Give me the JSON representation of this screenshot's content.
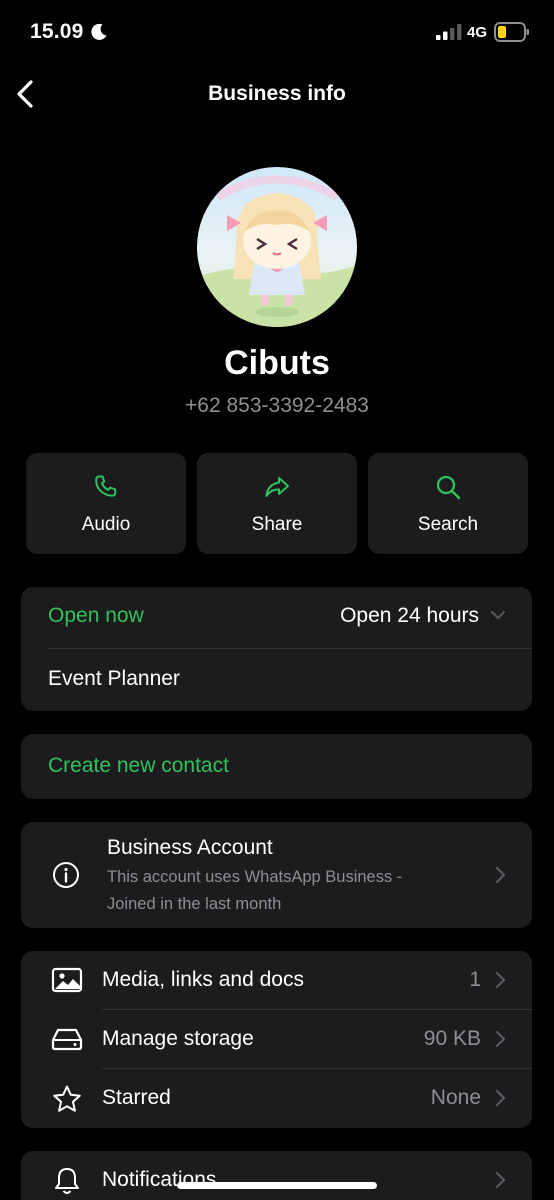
{
  "status_bar": {
    "time": "15.09",
    "network": "4G",
    "battery_color": "#ffd60a"
  },
  "header": {
    "title": "Business info"
  },
  "profile": {
    "name": "Cibuts",
    "phone": "+62 853-3392-2483"
  },
  "actions": [
    {
      "label": "Audio",
      "icon": "phone-icon"
    },
    {
      "label": "Share",
      "icon": "share-icon"
    },
    {
      "label": "Search",
      "icon": "search-icon"
    }
  ],
  "hours": {
    "status": "Open now",
    "value": "Open 24 hours",
    "category": "Event Planner"
  },
  "contact": {
    "create_label": "Create new contact"
  },
  "business_account": {
    "title": "Business Account",
    "description_line1": "This account uses WhatsApp Business -",
    "description_line2": "Joined in the last month"
  },
  "media": [
    {
      "label": "Media, links and docs",
      "value": "1",
      "icon": "image-icon"
    },
    {
      "label": "Manage storage",
      "value": "90 KB",
      "icon": "storage-icon"
    },
    {
      "label": "Starred",
      "value": "None",
      "icon": "star-icon"
    }
  ],
  "notifications": {
    "label": "Notifications",
    "icon": "bell-icon"
  },
  "colors": {
    "accent": "#30c25c",
    "card": "#1c1c1e",
    "background": "#000000",
    "secondary_text": "#8e8e93"
  }
}
